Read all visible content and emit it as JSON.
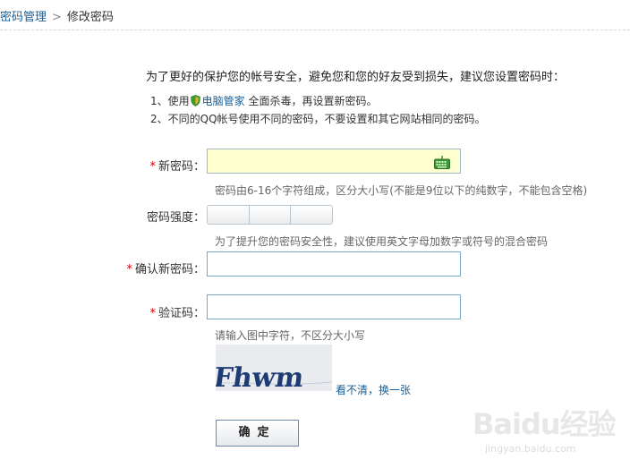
{
  "breadcrumb": {
    "parent": "密码管理",
    "separator": ">",
    "current": "修改密码"
  },
  "intro": "为了更好的保护您的帐号安全，避免您和您的好友受到损失，建议您设置密码时：",
  "tips": {
    "tip1_prefix": "1、使用",
    "tip1_link": "电脑管家",
    "tip1_suffix": "全面杀毒，再设置新密码。",
    "tip2": "2、不同的QQ帐号使用不同的密码，不要设置和其它网站相同的密码。"
  },
  "form": {
    "required_mark": "*",
    "new_password": {
      "label": "新密码：",
      "value": "",
      "hint": "密码由6-16个字符组成，区分大小写(不能是9位以下的纯数字，不能包含空格)"
    },
    "strength": {
      "label": "密码强度：",
      "hint": "为了提升您的密码安全性，建议使用英文字母加数字或符号的混合密码",
      "level": 0
    },
    "confirm_password": {
      "label": "确认新密码：",
      "value": ""
    },
    "captcha": {
      "label": "验证码：",
      "value": "",
      "hint": "请输入图中字符，不区分大小写",
      "image_text": "Fhwm",
      "refresh_link": "看不清，换一张"
    },
    "submit": "确定"
  },
  "watermark": {
    "logo": "Baidu经验",
    "url": "jingyan.baidu.com"
  },
  "colors": {
    "link": "#1a5f96",
    "required": "#d40000",
    "password_bg": "#ffffcf",
    "field_border": "#7aa6c6"
  },
  "icons": [
    "shield-icon",
    "keyboard-icon"
  ]
}
